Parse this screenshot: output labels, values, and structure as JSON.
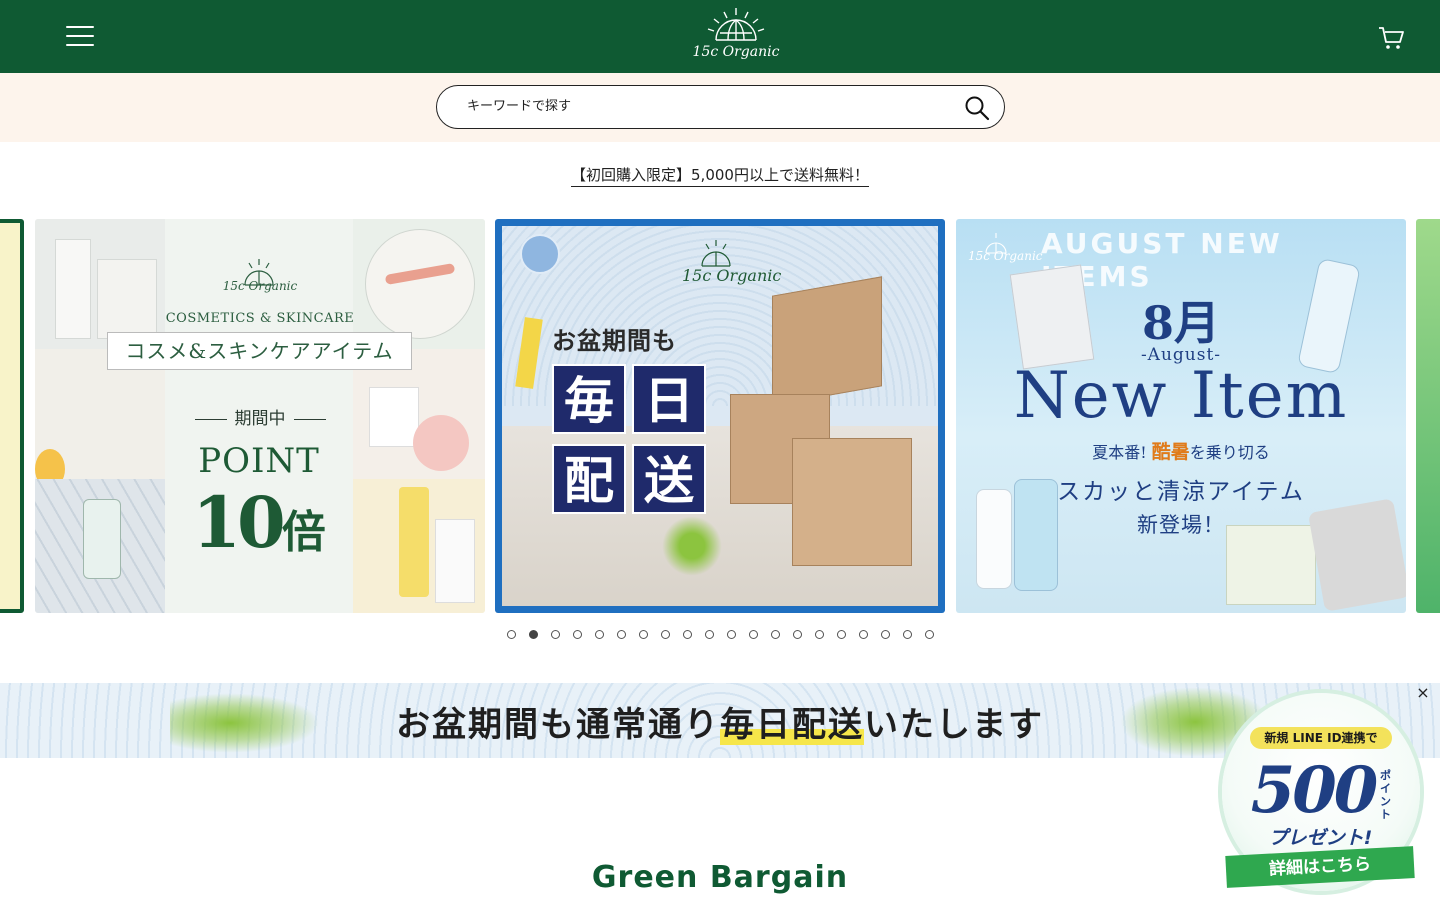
{
  "header": {
    "logo_text": "15c Organic",
    "menu_icon": "hamburger-menu-icon",
    "cart_icon": "cart-icon"
  },
  "search": {
    "placeholder": "キーワードで探す",
    "icon": "search-icon"
  },
  "promo": {
    "text": "【初回購入限定】5,000円以上で送料無料！"
  },
  "carousel": {
    "slides": [
      {
        "logo_text": "15c Organic",
        "subtitle": "COSMETICS & SKINCARE",
        "ribbon": "コスメ&スキンケアアイテム",
        "period": "期間中",
        "point": "POINT",
        "multiplier_number": "10",
        "multiplier_unit": "倍"
      },
      {
        "logo_text": "15c Organic",
        "title": "お盆期間も",
        "blocks": [
          "毎",
          "日",
          "配",
          "送"
        ]
      },
      {
        "logo_text": "15c Organic",
        "heading": "AUGUST NEW ITEMS",
        "month": "8月",
        "month_en": "-August-",
        "new_item": "New Item",
        "line1_pre": "夏本番!",
        "line1_hot": "酷暑",
        "line1_post": "を乗り切る",
        "line2": "スカッと清涼アイテム",
        "line3": "新登場！"
      }
    ],
    "dots_total": 20,
    "active_dot": 2
  },
  "banner": {
    "text_pre": "お盆期間も通常通り",
    "text_highlight": "毎日配送",
    "text_post": "いたします"
  },
  "section": {
    "title": "Green Bargain"
  },
  "popup": {
    "top": "新規 LINE ID連携で",
    "number": "500",
    "points_label": "ポイント",
    "gift": "プレゼント!",
    "cta": "詳細はこちら",
    "close": "×"
  },
  "colors": {
    "brand_green": "#0f5a33",
    "search_band": "#fdf4ec",
    "slide2_frame": "#1f6fc0",
    "navy": "#1f3f83",
    "line_green": "#2fa84f"
  }
}
